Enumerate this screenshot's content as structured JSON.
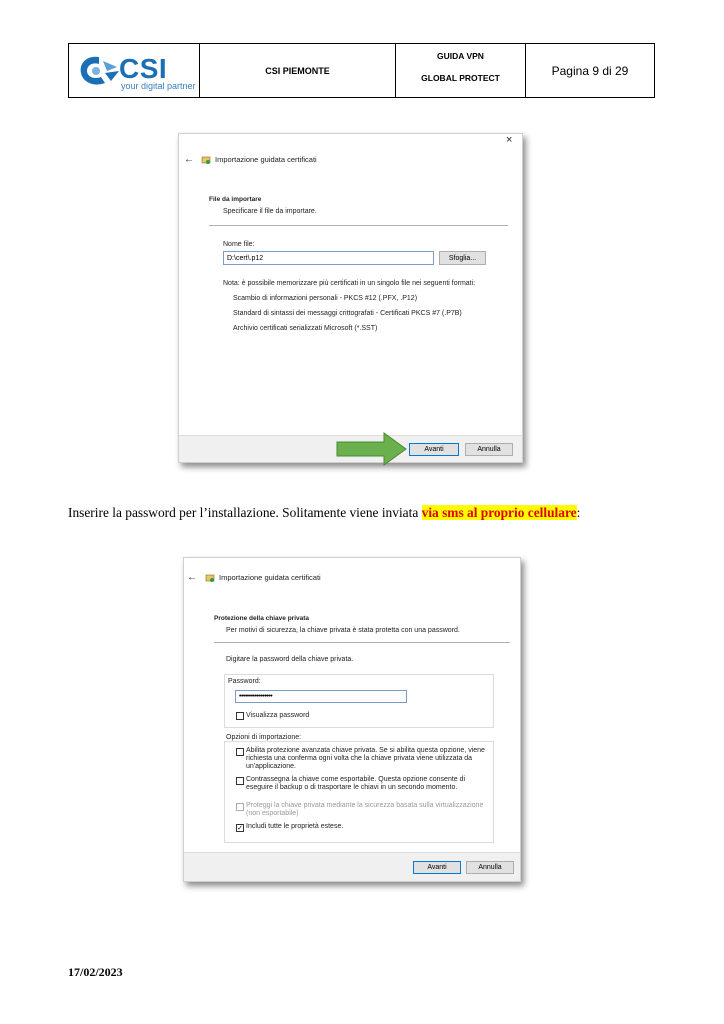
{
  "header": {
    "logo_text": "CSI",
    "logo_tagline": "your digital partner",
    "org": "CSI PIEMONTE",
    "doc_title_1": "GUIDA VPN",
    "doc_title_2": "GLOBAL PROTECT",
    "page": "Pagina 9 di 29"
  },
  "shot1": {
    "close": "×",
    "back": "←",
    "wizard_title": "Importazione guidata certificati",
    "section_title": "File da importare",
    "section_desc": "Specificare il file da importare.",
    "file_label": "Nome file:",
    "file_value": "D:\\cert\\.p12",
    "browse": "Sfoglia...",
    "note": "Nota: è possibile memorizzare più certificati in un singolo file nei seguenti formati:",
    "formats": [
      "Scambio di informazioni personali - PKCS #12 (.PFX, .P12)",
      "Standard di sintassi dei messaggi crittografati - Certificati PKCS #7 (.P7B)",
      "Archivio certificati serializzati Microsoft (*.SST)"
    ],
    "next": "Avanti",
    "cancel": "Annulla"
  },
  "paragraph": {
    "text": "Inserire la password per l’installazione. Solitamente viene inviata ",
    "highlight": "via sms al proprio cellulare",
    "end": ":"
  },
  "shot2": {
    "back": "←",
    "wizard_title": "Importazione guidata certificati",
    "section_title": "Protezione della chiave privata",
    "section_desc": "Per motivi di sicurezza, la chiave privata è stata protetta con una password.",
    "instruction": "Digitare la password della chiave privata.",
    "password_label": "Password:",
    "password_value": "•••••••••••••••••",
    "show_password": "Visualizza password",
    "options_label": "Opzioni di importazione:",
    "options": [
      "Abilita protezione avanzata chiave privata. Se si abilita questa opzione, viene richiesta una conferma ogni volta che la chiave privata viene utilizzata da un'applicazione.",
      "Contrassegna la chiave come esportabile. Questa opzione consente di eseguire il backup o di trasportare le chiavi in un secondo momento.",
      "Proteggi la chiave privata mediante la sicurezza basata sulla virtualizzazione (non esportabile)",
      "Includi tutte le proprietà estese."
    ],
    "next": "Avanti",
    "cancel": "Annulla"
  },
  "footer": {
    "date": "17/02/2023"
  },
  "colors": {
    "brand_blue": "#1a6fb5",
    "highlight": "#ffff00",
    "highlight_text": "#e00000",
    "arrow_green": "#6ab04c"
  }
}
